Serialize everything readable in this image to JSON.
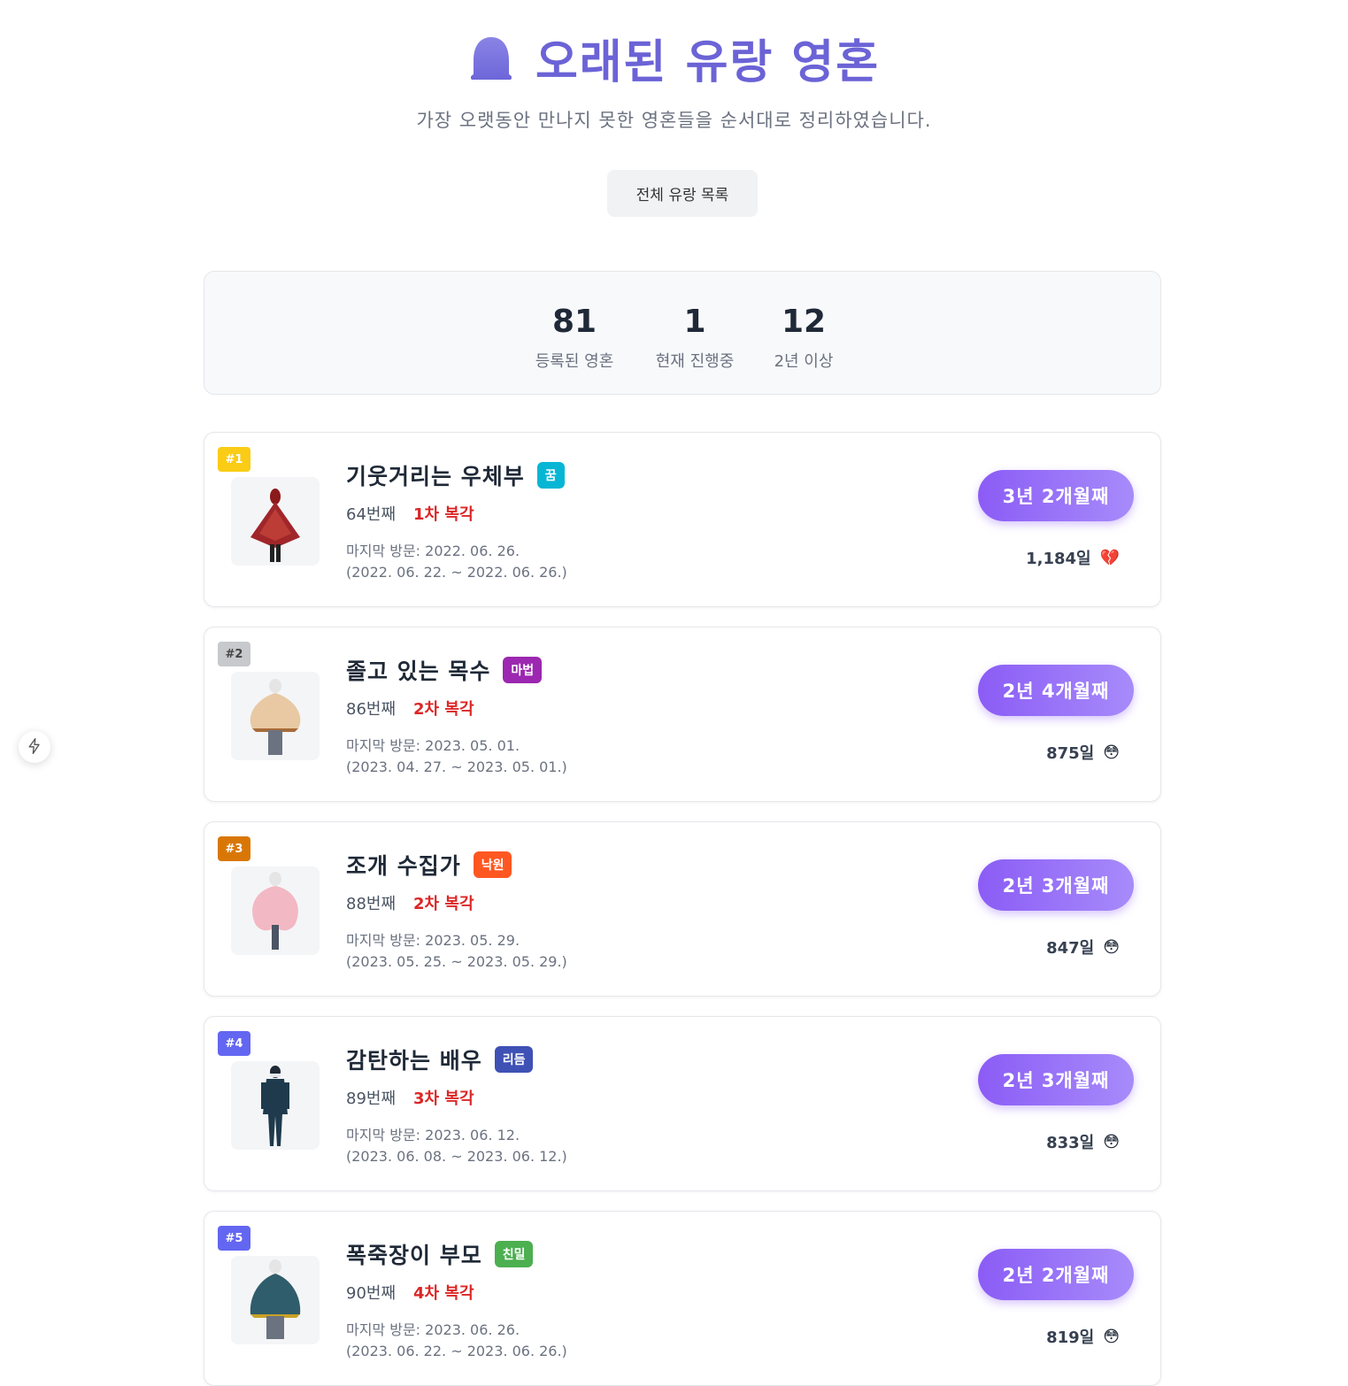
{
  "header": {
    "icon": "ghost-icon",
    "title": "오래된 유랑 영혼",
    "subtitle": "가장 오랫동안 만나지 못한 영혼들을 순서대로 정리하였습니다.",
    "list_button": "전체 유랑 목록"
  },
  "stats": [
    {
      "value": "81",
      "label": "등록된 영혼"
    },
    {
      "value": "1",
      "label": "현재 진행중"
    },
    {
      "value": "12",
      "label": "2년 이상"
    }
  ],
  "cards": [
    {
      "rank": "#1",
      "rank_color": "#facc15",
      "name": "기웃거리는 우체부",
      "tag": "꿈",
      "tag_color": "#06b6d4",
      "order": "64번째",
      "revival": "1차 복각",
      "last_visit": "마지막 방문: 2022. 06. 26.",
      "range": "(2022. 06. 22. ~ 2022. 06. 26.)",
      "elapsed": "3년 2개월째",
      "days": "1,184일",
      "emoji": "💔"
    },
    {
      "rank": "#2",
      "rank_color": "#c7c9cc",
      "name": "졸고 있는 목수",
      "tag": "마법",
      "tag_color": "#9c27b0",
      "order": "86번째",
      "revival": "2차 복각",
      "last_visit": "마지막 방문: 2023. 05. 01.",
      "range": "(2023. 04. 27. ~ 2023. 05. 01.)",
      "elapsed": "2년 4개월째",
      "days": "875일",
      "emoji": "😳"
    },
    {
      "rank": "#3",
      "rank_color": "#d97706",
      "name": "조개 수집가",
      "tag": "낙원",
      "tag_color": "#ff5722",
      "order": "88번째",
      "revival": "2차 복각",
      "last_visit": "마지막 방문: 2023. 05. 29.",
      "range": "(2023. 05. 25. ~ 2023. 05. 29.)",
      "elapsed": "2년 3개월째",
      "days": "847일",
      "emoji": "😳"
    },
    {
      "rank": "#4",
      "rank_color": "#6366f1",
      "name": "감탄하는 배우",
      "tag": "리듬",
      "tag_color": "#3f51b5",
      "order": "89번째",
      "revival": "3차 복각",
      "last_visit": "마지막 방문: 2023. 06. 12.",
      "range": "(2023. 06. 08. ~ 2023. 06. 12.)",
      "elapsed": "2년 3개월째",
      "days": "833일",
      "emoji": "😳"
    },
    {
      "rank": "#5",
      "rank_color": "#6366f1",
      "name": "폭죽장이 부모",
      "tag": "친밀",
      "tag_color": "#4caf50",
      "order": "90번째",
      "revival": "4차 복각",
      "last_visit": "마지막 방문: 2023. 06. 26.",
      "range": "(2023. 06. 22. ~ 2023. 06. 26.)",
      "elapsed": "2년 2개월째",
      "days": "819일",
      "emoji": "😳"
    }
  ],
  "side_button_icon": "lightning-icon"
}
